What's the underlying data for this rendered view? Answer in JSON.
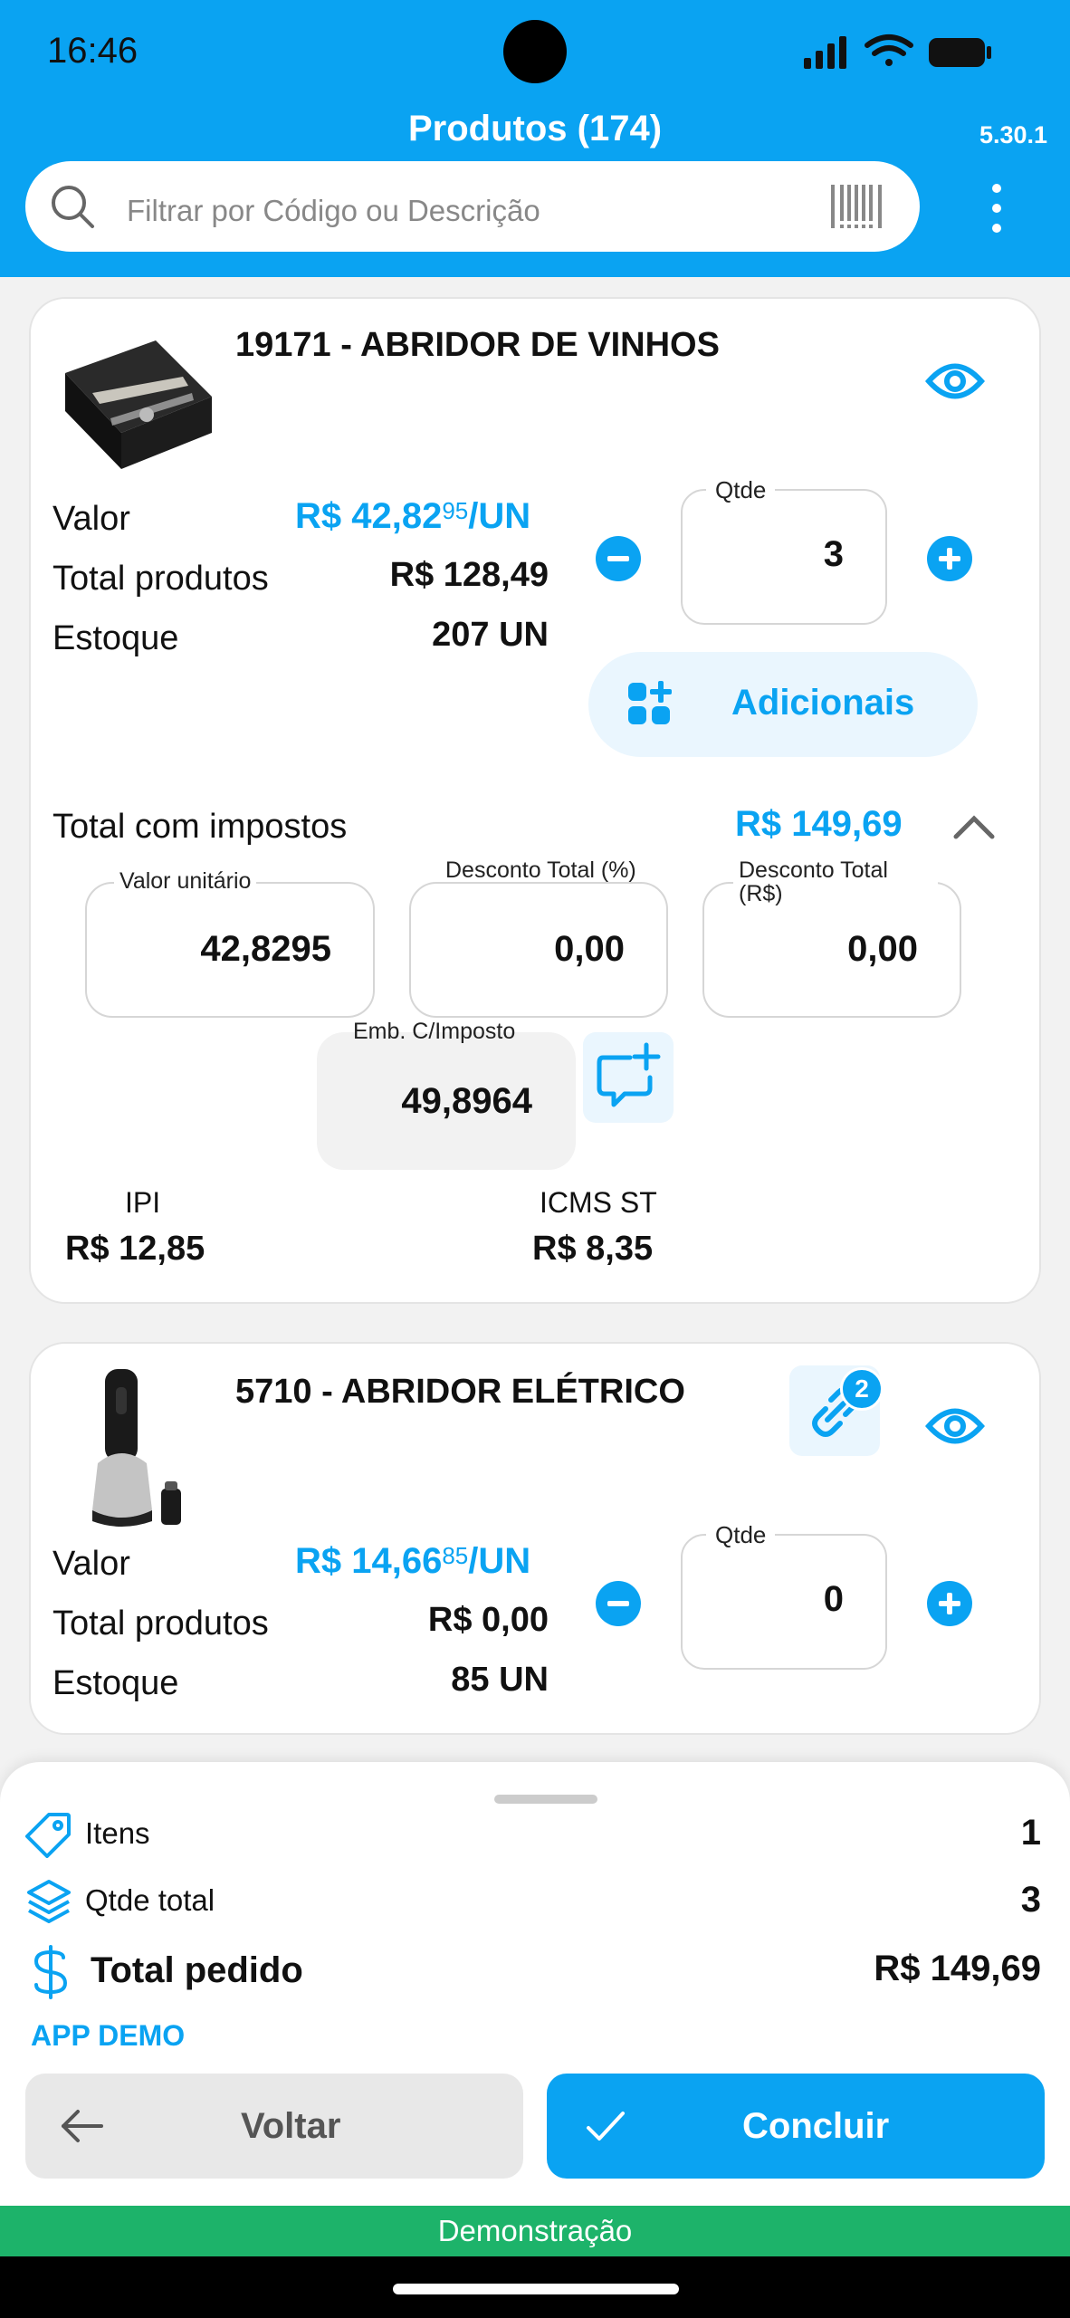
{
  "status": {
    "time": "16:46"
  },
  "header": {
    "title": "Produtos (174)",
    "version": "5.30.1",
    "search_placeholder": "Filtrar por Código ou Descrição"
  },
  "products": [
    {
      "title": "19171 - ABRIDOR DE VINHOS",
      "valor_label": "Valor",
      "valor_main": "R$ 42,82",
      "valor_sup": "95",
      "valor_unit": "/UN",
      "total_label": "Total produtos",
      "total_value": "R$ 128,49",
      "estoque_label": "Estoque",
      "estoque_value": "207 UN",
      "qty_label": "Qtde",
      "qty_value": "3",
      "adicionais_label": "Adicionais",
      "impostos_label": "Total com impostos",
      "impostos_value": "R$ 149,69",
      "valor_unitario_label": "Valor unitário",
      "valor_unitario_value": "42,8295",
      "desc_pct_label": "Desconto Total (%)",
      "desc_pct_value": "0,00",
      "desc_rs_label": "Desconto Total (R$)",
      "desc_rs_value": "0,00",
      "emb_label": "Emb. C/Imposto",
      "emb_value": "49,8964",
      "ipi_label": "IPI",
      "ipi_value": "R$ 12,85",
      "icms_label": "ICMS ST",
      "icms_value": "R$ 8,35"
    },
    {
      "title": "5710 - ABRIDOR ELÉTRICO",
      "link_badge": "2",
      "valor_label": "Valor",
      "valor_main": "R$ 14,66",
      "valor_sup": "85",
      "valor_unit": "/UN",
      "total_label": "Total produtos",
      "total_value": "R$ 0,00",
      "estoque_label": "Estoque",
      "estoque_value": "85 UN",
      "qty_label": "Qtde",
      "qty_value": "0"
    }
  ],
  "summary": {
    "itens_label": "Itens",
    "itens_value": "1",
    "qtde_label": "Qtde total",
    "qtde_value": "3",
    "total_label": "Total pedido",
    "total_value": "R$ 149,69",
    "app_label": "APP DEMO"
  },
  "actions": {
    "back_label": "Voltar",
    "done_label": "Concluir"
  },
  "footer": {
    "demo_label": "Demonstração"
  },
  "colors": {
    "accent": "#0aa3f2",
    "demo": "#1db36a"
  }
}
